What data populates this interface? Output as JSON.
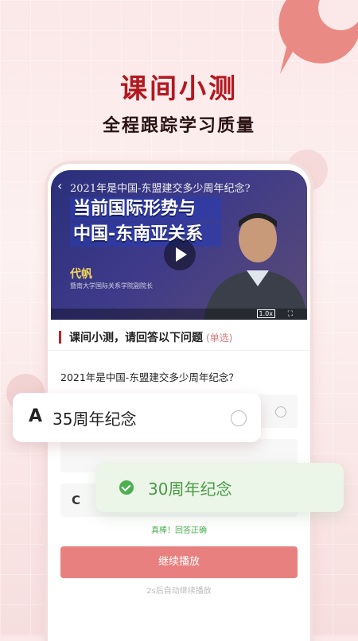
{
  "header": {
    "title": "课间小测",
    "subtitle": "全程跟踪学习质量"
  },
  "video": {
    "question_overlay": "2021年是中国-东盟建交多少周年纪念?",
    "headline_line1": "当前国际形势与",
    "headline_line2": "中国-东南亚关系",
    "speaker_name": "代帆",
    "speaker_title": "暨南大学国际关系学院副院长",
    "speed_label": "1.0x"
  },
  "quiz": {
    "title": "课间小测，请回答以下问题",
    "tag": "(单选)",
    "question": "2021年是中国-东盟建交多少周年纪念？",
    "option_c_letter": "C",
    "feedback": "真棒！回答正确",
    "continue_label": "继续播放",
    "auto_note": "2s后自动继续播放"
  },
  "option_a": {
    "letter": "A",
    "text": "35周年纪念"
  },
  "option_b": {
    "text": "30周年纪念"
  },
  "colors": {
    "accent": "#b31820",
    "success": "#4caf50",
    "button": "#e88080"
  }
}
